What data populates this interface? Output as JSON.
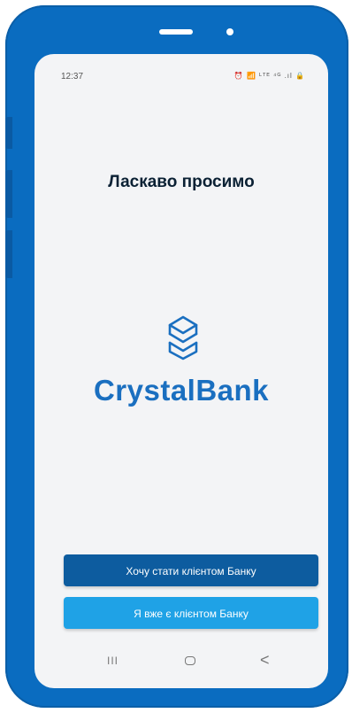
{
  "status_bar": {
    "time": "12:37",
    "icons_text": "⏰ 📶 ᴸᵀᴱ ⁴ᴳ .ıl 🔒"
  },
  "welcome_title": "Ласкаво просимо",
  "brand": {
    "name": "CrystalBank",
    "color": "#1a6fc0"
  },
  "buttons": {
    "become_client": "Хочу стати клієнтом Банку",
    "already_client": "Я вже є клієнтом Банку"
  },
  "nav_bar": {
    "recent_glyph": "III",
    "back_glyph": "<"
  },
  "colors": {
    "frame": "#0a6cc0",
    "primary_button": "#0d5c9f",
    "secondary_button": "#1fa2e6",
    "title": "#0b2134"
  }
}
